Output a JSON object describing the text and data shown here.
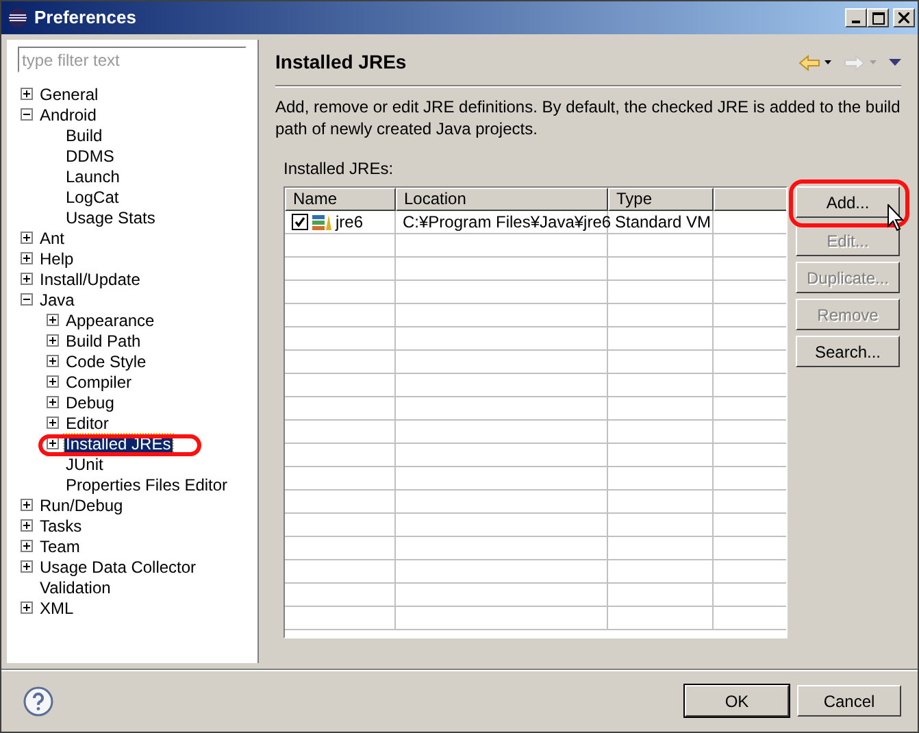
{
  "window": {
    "title": "Preferences"
  },
  "filter": {
    "placeholder": "type filter text"
  },
  "tree": [
    {
      "label": "General",
      "expanded": false,
      "selected": false
    },
    {
      "label": "Android",
      "expanded": true,
      "selected": false,
      "children": [
        {
          "label": "Build",
          "selected": false
        },
        {
          "label": "DDMS",
          "selected": false
        },
        {
          "label": "Launch",
          "selected": false
        },
        {
          "label": "LogCat",
          "selected": false
        },
        {
          "label": "Usage Stats",
          "selected": false
        }
      ]
    },
    {
      "label": "Ant",
      "expanded": false,
      "selected": false
    },
    {
      "label": "Help",
      "expanded": false,
      "selected": false
    },
    {
      "label": "Install/Update",
      "expanded": false,
      "selected": false
    },
    {
      "label": "Java",
      "expanded": true,
      "selected": false,
      "children": [
        {
          "label": "Appearance",
          "expanded": false,
          "selected": false
        },
        {
          "label": "Build Path",
          "expanded": false,
          "selected": false
        },
        {
          "label": "Code Style",
          "expanded": false,
          "selected": false
        },
        {
          "label": "Compiler",
          "expanded": false,
          "selected": false
        },
        {
          "label": "Debug",
          "expanded": false,
          "selected": false
        },
        {
          "label": "Editor",
          "expanded": false,
          "selected": false
        },
        {
          "label": "Installed JREs",
          "expanded": false,
          "selected": true
        },
        {
          "label": "JUnit",
          "selected": false
        },
        {
          "label": "Properties Files Editor",
          "selected": false
        }
      ]
    },
    {
      "label": "Run/Debug",
      "expanded": false,
      "selected": false
    },
    {
      "label": "Tasks",
      "expanded": false,
      "selected": false
    },
    {
      "label": "Team",
      "expanded": false,
      "selected": false
    },
    {
      "label": "Usage Data Collector",
      "expanded": false,
      "selected": false
    },
    {
      "label": "Validation",
      "selected": false
    },
    {
      "label": "XML",
      "expanded": false,
      "selected": false
    }
  ],
  "page": {
    "title": "Installed JREs",
    "description": "Add, remove or edit JRE definitions. By default, the checked JRE is added to the build path of newly created Java projects.",
    "table_label": "Installed JREs:"
  },
  "table": {
    "columns": [
      "Name",
      "Location",
      "Type"
    ],
    "rows": [
      {
        "checked": true,
        "name": "jre6",
        "location": "C:¥Program Files¥Java¥jre6",
        "type": "Standard VM"
      }
    ]
  },
  "side_buttons": [
    {
      "label": "Add...",
      "disabled": false
    },
    {
      "label": "Edit...",
      "disabled": true
    },
    {
      "label": "Duplicate...",
      "disabled": true
    },
    {
      "label": "Remove",
      "disabled": true
    },
    {
      "label": "Search...",
      "disabled": false
    }
  ],
  "footer_buttons": [
    {
      "label": "OK",
      "default": true
    },
    {
      "label": "Cancel",
      "default": false
    }
  ]
}
